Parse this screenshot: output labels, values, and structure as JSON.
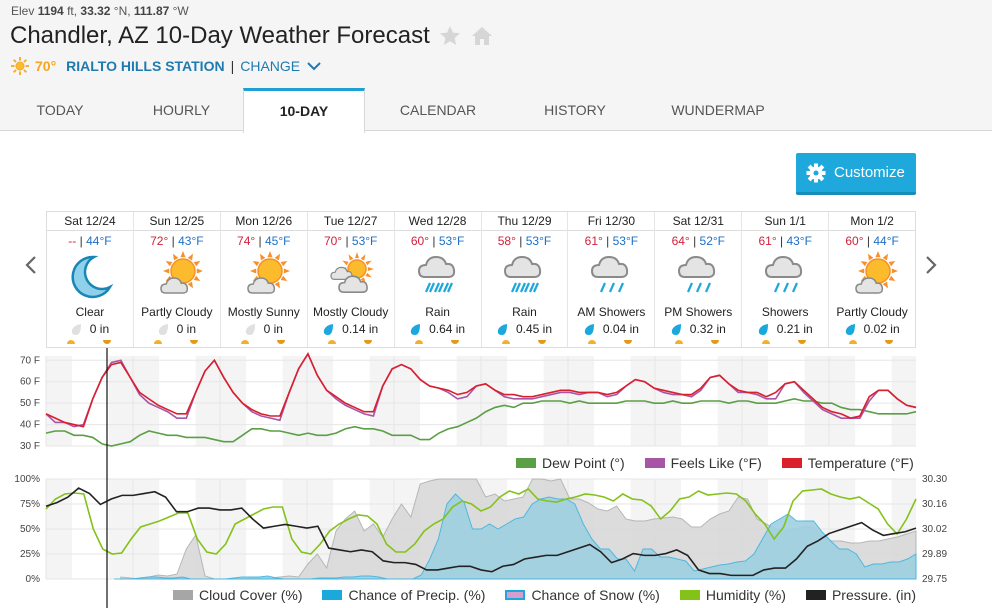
{
  "header": {
    "elev_prefix": "Elev ",
    "elev_value": "1194",
    "elev_unit": " ft, ",
    "lat_value": "33.32",
    "lat_unit": " °N, ",
    "lon_value": "111.87",
    "lon_unit": " °W",
    "title": "Chandler, AZ 10-Day Weather Forecast",
    "current_temp": "70°",
    "station": "RIALTO HILLS STATION",
    "separator": "|",
    "change_label": "CHANGE"
  },
  "tabs": [
    {
      "label": "TODAY",
      "active": false
    },
    {
      "label": "HOURLY",
      "active": false
    },
    {
      "label": "10-DAY",
      "active": true
    },
    {
      "label": "CALENDAR",
      "active": false
    },
    {
      "label": "HISTORY",
      "active": false
    },
    {
      "label": "WUNDERMAP",
      "active": false
    }
  ],
  "customize_label": "Customize",
  "days": [
    {
      "date": "Sat 12/24",
      "hi": "--",
      "lo": "44°F",
      "icon": "moon-icon",
      "condition": "Clear",
      "precip": "0 in",
      "wet": false
    },
    {
      "date": "Sun 12/25",
      "hi": "72°",
      "lo": "43°F",
      "icon": "partly-cloudy-icon",
      "condition": "Partly Cloudy",
      "precip": "0 in",
      "wet": false
    },
    {
      "date": "Mon 12/26",
      "hi": "74°",
      "lo": "45°F",
      "icon": "partly-cloudy-icon",
      "condition": "Mostly Sunny",
      "precip": "0 in",
      "wet": false
    },
    {
      "date": "Tue 12/27",
      "hi": "70°",
      "lo": "53°F",
      "icon": "mostly-cloudy-icon",
      "condition": "Mostly Cloudy",
      "precip": "0.14 in",
      "wet": true
    },
    {
      "date": "Wed 12/28",
      "hi": "60°",
      "lo": "53°F",
      "icon": "rain-icon",
      "condition": "Rain",
      "precip": "0.64 in",
      "wet": true
    },
    {
      "date": "Thu 12/29",
      "hi": "58°",
      "lo": "53°F",
      "icon": "rain-icon",
      "condition": "Rain",
      "precip": "0.45 in",
      "wet": true
    },
    {
      "date": "Fri 12/30",
      "hi": "61°",
      "lo": "53°F",
      "icon": "showers-icon",
      "condition": "AM Showers",
      "precip": "0.04 in",
      "wet": true
    },
    {
      "date": "Sat 12/31",
      "hi": "64°",
      "lo": "52°F",
      "icon": "showers-icon",
      "condition": "PM Showers",
      "precip": "0.32 in",
      "wet": true
    },
    {
      "date": "Sun 1/1",
      "hi": "61°",
      "lo": "43°F",
      "icon": "showers-icon",
      "condition": "Showers",
      "precip": "0.21 in",
      "wet": true
    },
    {
      "date": "Mon 1/2",
      "hi": "60°",
      "lo": "44°F",
      "icon": "partly-cloudy-icon",
      "condition": "Partly Cloudy",
      "precip": "0.02 in",
      "wet": true
    }
  ],
  "colors": {
    "accent": "#1ea8dc",
    "hi": "#d0213b",
    "lo": "#1e6fc5",
    "temperature": "#d9202c",
    "feels_like": "#a855a8",
    "dew_point": "#5a9e45",
    "cloud_cover": "#a6a6a6",
    "precip": "#1ba8dc",
    "snow": "#d49fd0",
    "humidity": "#84c21a",
    "pressure": "#222222"
  },
  "chart_data": [
    {
      "type": "line",
      "title": "Temperature",
      "y_ticks": [
        "70 F",
        "60 F",
        "50 F",
        "40 F",
        "30 F"
      ],
      "ylim": [
        30,
        72
      ],
      "x_range_days": 10,
      "legend": [
        "Dew Point (°)",
        "Feels Like (°F)",
        "Temperature (°F)"
      ],
      "series": [
        {
          "name": "Temperature (°F)",
          "values": [
            45,
            43,
            41,
            40,
            39,
            52,
            62,
            68,
            69,
            62,
            55,
            52,
            49,
            47,
            45,
            45,
            55,
            65,
            70,
            62,
            55,
            50,
            47,
            45,
            44,
            44,
            55,
            66,
            73,
            63,
            56,
            53,
            50,
            48,
            46,
            46,
            58,
            66,
            68,
            66,
            61,
            58,
            57,
            56,
            54,
            55,
            58,
            59,
            56,
            54,
            54,
            53,
            53,
            54,
            55,
            56,
            56,
            55,
            55,
            55,
            54,
            55,
            58,
            61,
            60,
            57,
            56,
            55,
            54,
            54,
            57,
            62,
            63,
            59,
            56,
            55,
            55,
            53,
            55,
            59,
            60,
            56,
            52,
            48,
            46,
            45,
            43,
            44,
            53,
            56,
            56,
            52,
            49,
            48
          ]
        },
        {
          "name": "Feels Like (°F)",
          "values": [
            45,
            41,
            41,
            39,
            40,
            52,
            62,
            69,
            70,
            62,
            54,
            50,
            48,
            46,
            43,
            43,
            55,
            65,
            70,
            62,
            55,
            50,
            46,
            44,
            43,
            42,
            55,
            66,
            73,
            63,
            56,
            52,
            49,
            47,
            45,
            44,
            58,
            66,
            68,
            66,
            61,
            58,
            57,
            55,
            52,
            53,
            58,
            59,
            56,
            53,
            52,
            52,
            52,
            53,
            54,
            55,
            55,
            54,
            55,
            55,
            53,
            54,
            58,
            61,
            60,
            57,
            55,
            54,
            54,
            53,
            56,
            62,
            63,
            59,
            55,
            55,
            54,
            52,
            52,
            59,
            60,
            55,
            51,
            47,
            45,
            43,
            43,
            43,
            51,
            56,
            56,
            52,
            49,
            48
          ]
        },
        {
          "name": "Dew Point (°)",
          "values": [
            36,
            37,
            37,
            35,
            35,
            34,
            31,
            30,
            31,
            32,
            35,
            37,
            36,
            35,
            35,
            34,
            34,
            34,
            33,
            32,
            32,
            35,
            38,
            38,
            37,
            37,
            36,
            35,
            36,
            35,
            35,
            36,
            38,
            39,
            38,
            38,
            37,
            35,
            35,
            35,
            33,
            33,
            36,
            38,
            39,
            41,
            43,
            46,
            48,
            49,
            48,
            50,
            50,
            51,
            51,
            51,
            50,
            51,
            50,
            50,
            50,
            50,
            51,
            51,
            51,
            50,
            50,
            51,
            50,
            50,
            51,
            51,
            51,
            50,
            51,
            51,
            50,
            50,
            50,
            51,
            52,
            51,
            51,
            50,
            50,
            48,
            47,
            47,
            46,
            45,
            45,
            45,
            45,
            46
          ]
        }
      ]
    },
    {
      "type": "area",
      "title": "Precipitation / Humidity / Pressure",
      "y_ticks_left": [
        "100%",
        "75%",
        "50%",
        "25%",
        "0%"
      ],
      "y_ticks_right": [
        "30.30",
        "30.16",
        "30.02",
        "29.89",
        "29.75"
      ],
      "ylim_left": [
        0,
        100
      ],
      "ylim_right": [
        29.75,
        30.3
      ],
      "legend": [
        "Cloud Cover (%)",
        "Chance of Precip. (%)",
        "Chance of Snow (%)",
        "Humidity (%)",
        "Pressure. (in)"
      ],
      "series": [
        {
          "name": "Cloud Cover (%)",
          "values": [
            null,
            null,
            null,
            null,
            null,
            null,
            null,
            null,
            2,
            1,
            0,
            2,
            4,
            3,
            5,
            30,
            44,
            3,
            0,
            0,
            0,
            0,
            1,
            2,
            1,
            2,
            3,
            2,
            15,
            25,
            11,
            48,
            60,
            68,
            48,
            55,
            42,
            60,
            75,
            62,
            95,
            98,
            100,
            100,
            100,
            100,
            100,
            82,
            85,
            78,
            80,
            82,
            100,
            100,
            98,
            100,
            80,
            80,
            76,
            70,
            68,
            73,
            60,
            58,
            58,
            60,
            61,
            62,
            60,
            52,
            52,
            60,
            65,
            68,
            82,
            80,
            60,
            55,
            50,
            48,
            50,
            52,
            52,
            42,
            38,
            38,
            36,
            36,
            38,
            38,
            40,
            42,
            45,
            48
          ]
        },
        {
          "name": "Chance of Precip. (%)",
          "values": [
            null,
            null,
            null,
            null,
            null,
            null,
            null,
            null,
            0,
            0,
            0,
            1,
            2,
            2,
            1,
            1,
            2,
            0,
            0,
            0,
            0,
            0,
            1,
            2,
            2,
            2,
            3,
            1,
            0,
            0,
            0,
            0,
            1,
            1,
            1,
            2,
            2,
            3,
            3,
            2,
            0,
            0,
            0,
            0,
            4,
            20,
            40,
            75,
            85,
            77,
            50,
            50,
            55,
            50,
            55,
            60,
            62,
            75,
            80,
            82,
            80,
            80,
            75,
            55,
            40,
            30,
            30,
            20,
            20,
            8,
            30,
            30,
            22,
            22,
            20,
            18,
            8,
            10,
            12,
            14,
            15,
            17,
            18,
            25,
            40,
            55,
            60,
            65,
            58,
            58,
            58,
            47,
            38,
            30,
            30,
            25,
            12,
            15,
            15,
            17,
            17,
            20,
            25
          ]
        },
        {
          "name": "Humidity (%)",
          "values": [
            70,
            80,
            85,
            86,
            85,
            50,
            30,
            25,
            26,
            40,
            52,
            55,
            58,
            62,
            66,
            66,
            40,
            27,
            25,
            35,
            55,
            60,
            65,
            70,
            72,
            72,
            40,
            27,
            25,
            35,
            48,
            55,
            60,
            64,
            63,
            55,
            35,
            27,
            27,
            35,
            48,
            55,
            60,
            72,
            78,
            75,
            68,
            72,
            82,
            88,
            85,
            90,
            80,
            78,
            77,
            80,
            82,
            85,
            84,
            82,
            78,
            85,
            80,
            79,
            73,
            60,
            68,
            80,
            82,
            88,
            84,
            85,
            86,
            85,
            78,
            65,
            55,
            40,
            52,
            78,
            88,
            89,
            90,
            85,
            82,
            80,
            82,
            76,
            70,
            55,
            45,
            60,
            80
          ]
        },
        {
          "name": "Pressure. (in)",
          "values": [
            30.15,
            30.17,
            30.2,
            30.25,
            30.22,
            30.16,
            30.19,
            30.21,
            30.21,
            30.22,
            30.23,
            30.2,
            30.12,
            30.12,
            30.14,
            30.14,
            30.13,
            30.13,
            30.14,
            30.08,
            30.03,
            30.04,
            30.05,
            30.04,
            30.03,
            30.04,
            29.92,
            29.91,
            29.9,
            29.91,
            29.9,
            29.85,
            29.84,
            29.84,
            29.83,
            29.8,
            29.8,
            29.81,
            29.82,
            29.82,
            29.8,
            29.79,
            29.82,
            29.83,
            29.86,
            29.87,
            29.88,
            29.88,
            29.9,
            29.92,
            29.94,
            29.9,
            29.84,
            29.86,
            29.89,
            29.88,
            29.88,
            29.89,
            29.91,
            29.88,
            29.8,
            29.78,
            29.78,
            29.77,
            29.77,
            29.77,
            29.8,
            29.81,
            29.81,
            29.86,
            29.93,
            29.96,
            30.0,
            30.02,
            30.04,
            30.06,
            30.02,
            29.99,
            30.0,
            30.01,
            30.03
          ]
        }
      ]
    }
  ]
}
